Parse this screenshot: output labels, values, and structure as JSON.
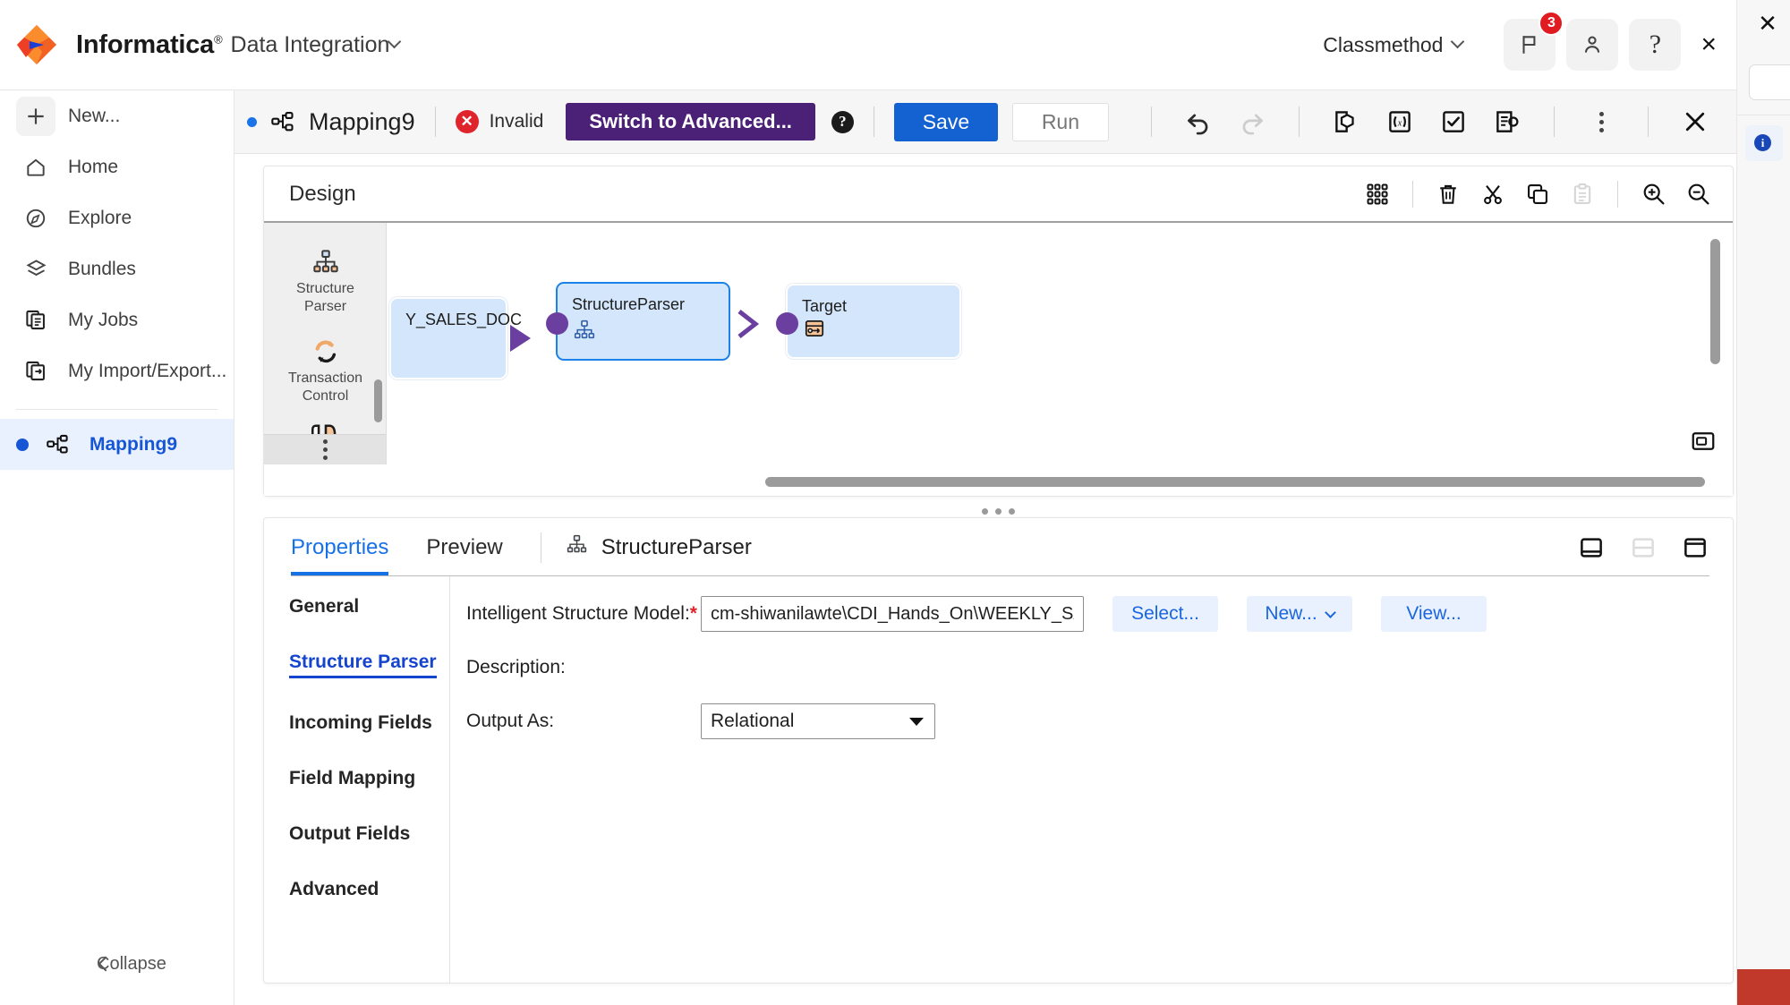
{
  "header": {
    "brand": "Informatica",
    "brand_mark": "®",
    "product": "Data Integration",
    "org": "Classmethod",
    "notifications_count": "3",
    "help_glyph": "?",
    "close_glyph": "×",
    "icons": {
      "flag": "flag-icon",
      "user": "user-icon",
      "help": "help-icon"
    }
  },
  "sidebar": {
    "items": [
      {
        "label": "New...",
        "icon": "plus-icon"
      },
      {
        "label": "Home",
        "icon": "home-icon"
      },
      {
        "label": "Explore",
        "icon": "compass-icon"
      },
      {
        "label": "Bundles",
        "icon": "layers-icon"
      },
      {
        "label": "My Jobs",
        "icon": "jobs-icon"
      },
      {
        "label": "My Import/Export...",
        "icon": "import-export-icon"
      }
    ],
    "active_item": {
      "label": "Mapping9",
      "icon": "mapping-icon"
    },
    "collapse_label": "Collapse"
  },
  "mapping_toolbar": {
    "title": "Mapping9",
    "status": "Invalid",
    "status_glyph": "✕",
    "switch_advanced": "Switch to Advanced...",
    "help_glyph": "?",
    "save": "Save",
    "run": "Run",
    "icons": [
      "undo-icon",
      "redo-icon",
      "parameter-icon",
      "expression-icon",
      "validate-icon",
      "documentation-icon",
      "more-options-icon",
      "close-icon"
    ]
  },
  "design": {
    "title": "Design",
    "toolbar_icons": [
      "grid-icon",
      "delete-icon",
      "cut-icon",
      "copy-icon",
      "paste-icon",
      "zoom-in-icon",
      "zoom-out-icon"
    ],
    "fit-to-window-icon": "fit-to-window-icon",
    "palette": [
      {
        "label": "Structure\nParser",
        "icon": "structure-parser-icon"
      },
      {
        "label": "Transaction\nControl",
        "icon": "transaction-control-icon"
      }
    ],
    "palette_more": "more-transformations-icon",
    "nodes": [
      {
        "name": "Y_SALES_DOC",
        "icon": "source-icon",
        "selected": false
      },
      {
        "name": "StructureParser",
        "icon": "structure-parser-icon",
        "selected": true
      },
      {
        "name": "Target",
        "icon": "target-icon",
        "selected": false
      }
    ]
  },
  "properties": {
    "tabs": [
      {
        "label": "Properties",
        "active": true
      },
      {
        "label": "Preview",
        "active": false
      }
    ],
    "node_label": "StructureParser",
    "node_icon": "structure-parser-icon",
    "layout_icons": [
      "panel-collapse-icon",
      "panel-split-icon",
      "panel-expand-icon"
    ],
    "nav": [
      {
        "label": "General",
        "active": false
      },
      {
        "label": "Structure Parser",
        "active": true
      },
      {
        "label": "Incoming Fields",
        "active": false
      },
      {
        "label": "Field Mapping",
        "active": false
      },
      {
        "label": "Output Fields",
        "active": false
      },
      {
        "label": "Advanced",
        "active": false
      }
    ],
    "form": {
      "model_label": "Intelligent Structure Model:",
      "model_required": "*",
      "model_value": "cm-shiwanilawte\\CDI_Hands_On\\WEEKLY_SALES",
      "select_button": "Select...",
      "new_button": "New...",
      "view_button": "View...",
      "description_label": "Description:",
      "output_as_label": "Output As:",
      "output_as_value": "Relational"
    }
  },
  "colors": {
    "accent_blue": "#1461d2",
    "advanced_purple": "#4b2177",
    "invalid_red": "#e0242c",
    "node_fill": "#d3e6fb",
    "port_purple": "#6b3fa0"
  }
}
